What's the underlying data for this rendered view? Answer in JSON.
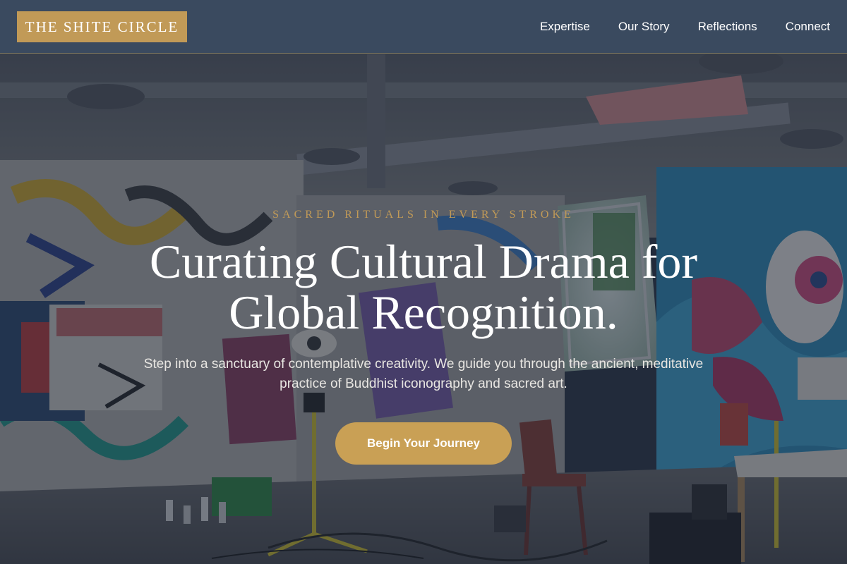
{
  "header": {
    "logo_text": "THE SHITE CIRCLE",
    "nav": [
      {
        "label": "Expertise"
      },
      {
        "label": "Our Story"
      },
      {
        "label": "Reflections"
      },
      {
        "label": "Connect"
      }
    ]
  },
  "hero": {
    "eyebrow": "SACRED RITUALS IN EVERY STROKE",
    "headline_line1": "Curating Cultural Drama for",
    "headline_line2": "Global Recognition.",
    "subtext": "Step into a sanctuary of contemplative creativity. We guide you through the ancient, meditative practice of Buddhist iconography and sacred art.",
    "cta_label": "Begin Your Journey",
    "background_description_icon": "graffiti-studio-photo"
  },
  "colors": {
    "header_bg": "#3a4a5f",
    "accent_gold": "#c19a57",
    "cta_bg": "#c9a055",
    "text_light": "#ffffff"
  }
}
